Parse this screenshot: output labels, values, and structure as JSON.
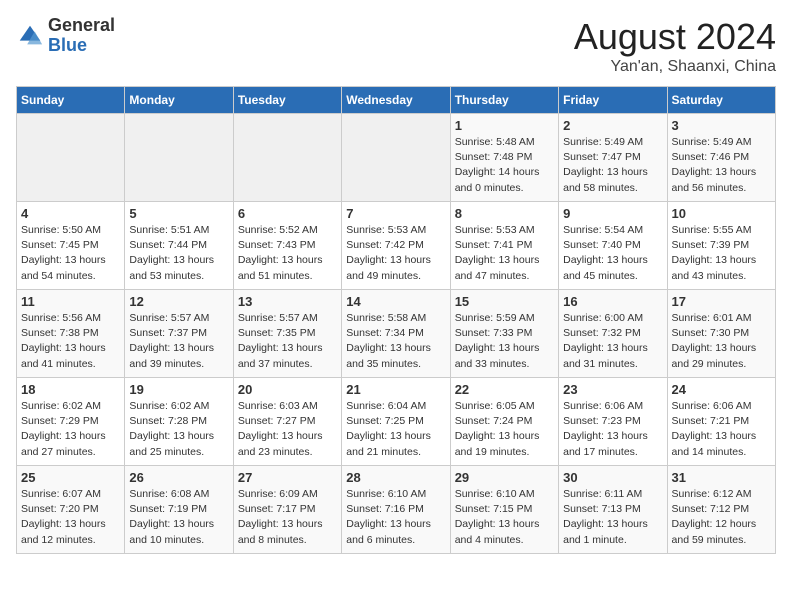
{
  "header": {
    "logo_line1": "General",
    "logo_line2": "Blue",
    "month_year": "August 2024",
    "location": "Yan'an, Shaanxi, China"
  },
  "weekdays": [
    "Sunday",
    "Monday",
    "Tuesday",
    "Wednesday",
    "Thursday",
    "Friday",
    "Saturday"
  ],
  "weeks": [
    [
      {
        "day": "",
        "info": ""
      },
      {
        "day": "",
        "info": ""
      },
      {
        "day": "",
        "info": ""
      },
      {
        "day": "",
        "info": ""
      },
      {
        "day": "1",
        "info": "Sunrise: 5:48 AM\nSunset: 7:48 PM\nDaylight: 14 hours\nand 0 minutes."
      },
      {
        "day": "2",
        "info": "Sunrise: 5:49 AM\nSunset: 7:47 PM\nDaylight: 13 hours\nand 58 minutes."
      },
      {
        "day": "3",
        "info": "Sunrise: 5:49 AM\nSunset: 7:46 PM\nDaylight: 13 hours\nand 56 minutes."
      }
    ],
    [
      {
        "day": "4",
        "info": "Sunrise: 5:50 AM\nSunset: 7:45 PM\nDaylight: 13 hours\nand 54 minutes."
      },
      {
        "day": "5",
        "info": "Sunrise: 5:51 AM\nSunset: 7:44 PM\nDaylight: 13 hours\nand 53 minutes."
      },
      {
        "day": "6",
        "info": "Sunrise: 5:52 AM\nSunset: 7:43 PM\nDaylight: 13 hours\nand 51 minutes."
      },
      {
        "day": "7",
        "info": "Sunrise: 5:53 AM\nSunset: 7:42 PM\nDaylight: 13 hours\nand 49 minutes."
      },
      {
        "day": "8",
        "info": "Sunrise: 5:53 AM\nSunset: 7:41 PM\nDaylight: 13 hours\nand 47 minutes."
      },
      {
        "day": "9",
        "info": "Sunrise: 5:54 AM\nSunset: 7:40 PM\nDaylight: 13 hours\nand 45 minutes."
      },
      {
        "day": "10",
        "info": "Sunrise: 5:55 AM\nSunset: 7:39 PM\nDaylight: 13 hours\nand 43 minutes."
      }
    ],
    [
      {
        "day": "11",
        "info": "Sunrise: 5:56 AM\nSunset: 7:38 PM\nDaylight: 13 hours\nand 41 minutes."
      },
      {
        "day": "12",
        "info": "Sunrise: 5:57 AM\nSunset: 7:37 PM\nDaylight: 13 hours\nand 39 minutes."
      },
      {
        "day": "13",
        "info": "Sunrise: 5:57 AM\nSunset: 7:35 PM\nDaylight: 13 hours\nand 37 minutes."
      },
      {
        "day": "14",
        "info": "Sunrise: 5:58 AM\nSunset: 7:34 PM\nDaylight: 13 hours\nand 35 minutes."
      },
      {
        "day": "15",
        "info": "Sunrise: 5:59 AM\nSunset: 7:33 PM\nDaylight: 13 hours\nand 33 minutes."
      },
      {
        "day": "16",
        "info": "Sunrise: 6:00 AM\nSunset: 7:32 PM\nDaylight: 13 hours\nand 31 minutes."
      },
      {
        "day": "17",
        "info": "Sunrise: 6:01 AM\nSunset: 7:30 PM\nDaylight: 13 hours\nand 29 minutes."
      }
    ],
    [
      {
        "day": "18",
        "info": "Sunrise: 6:02 AM\nSunset: 7:29 PM\nDaylight: 13 hours\nand 27 minutes."
      },
      {
        "day": "19",
        "info": "Sunrise: 6:02 AM\nSunset: 7:28 PM\nDaylight: 13 hours\nand 25 minutes."
      },
      {
        "day": "20",
        "info": "Sunrise: 6:03 AM\nSunset: 7:27 PM\nDaylight: 13 hours\nand 23 minutes."
      },
      {
        "day": "21",
        "info": "Sunrise: 6:04 AM\nSunset: 7:25 PM\nDaylight: 13 hours\nand 21 minutes."
      },
      {
        "day": "22",
        "info": "Sunrise: 6:05 AM\nSunset: 7:24 PM\nDaylight: 13 hours\nand 19 minutes."
      },
      {
        "day": "23",
        "info": "Sunrise: 6:06 AM\nSunset: 7:23 PM\nDaylight: 13 hours\nand 17 minutes."
      },
      {
        "day": "24",
        "info": "Sunrise: 6:06 AM\nSunset: 7:21 PM\nDaylight: 13 hours\nand 14 minutes."
      }
    ],
    [
      {
        "day": "25",
        "info": "Sunrise: 6:07 AM\nSunset: 7:20 PM\nDaylight: 13 hours\nand 12 minutes."
      },
      {
        "day": "26",
        "info": "Sunrise: 6:08 AM\nSunset: 7:19 PM\nDaylight: 13 hours\nand 10 minutes."
      },
      {
        "day": "27",
        "info": "Sunrise: 6:09 AM\nSunset: 7:17 PM\nDaylight: 13 hours\nand 8 minutes."
      },
      {
        "day": "28",
        "info": "Sunrise: 6:10 AM\nSunset: 7:16 PM\nDaylight: 13 hours\nand 6 minutes."
      },
      {
        "day": "29",
        "info": "Sunrise: 6:10 AM\nSunset: 7:15 PM\nDaylight: 13 hours\nand 4 minutes."
      },
      {
        "day": "30",
        "info": "Sunrise: 6:11 AM\nSunset: 7:13 PM\nDaylight: 13 hours\nand 1 minute."
      },
      {
        "day": "31",
        "info": "Sunrise: 6:12 AM\nSunset: 7:12 PM\nDaylight: 12 hours\nand 59 minutes."
      }
    ]
  ]
}
